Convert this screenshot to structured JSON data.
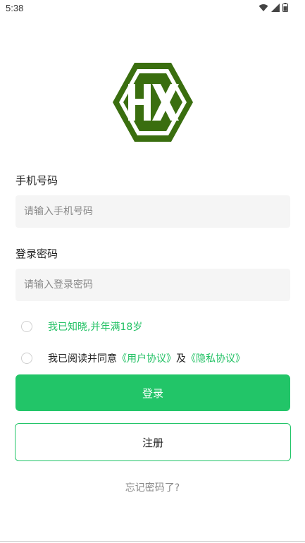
{
  "status_bar": {
    "time": "5:38",
    "icons": [
      "wifi-icon",
      "signal-icon",
      "battery-icon"
    ]
  },
  "logo": {
    "text": "HX",
    "color": "#3a6e0f"
  },
  "phone": {
    "label": "手机号码",
    "placeholder": "请输入手机号码",
    "value": ""
  },
  "password": {
    "label": "登录密码",
    "placeholder": "请输入登录密码",
    "value": ""
  },
  "agreements": {
    "age_text": "我已知晓,并年满18岁",
    "read_prefix": "我已阅读并同意",
    "user_agreement": "《用户协议》",
    "and": "及",
    "privacy_agreement": "《隐私协议》"
  },
  "buttons": {
    "login": "登录",
    "register": "注册"
  },
  "forgot_password": "忘记密码了?",
  "colors": {
    "accent": "#22c568",
    "link_green": "#22c164",
    "input_bg": "#f5f5f5"
  }
}
